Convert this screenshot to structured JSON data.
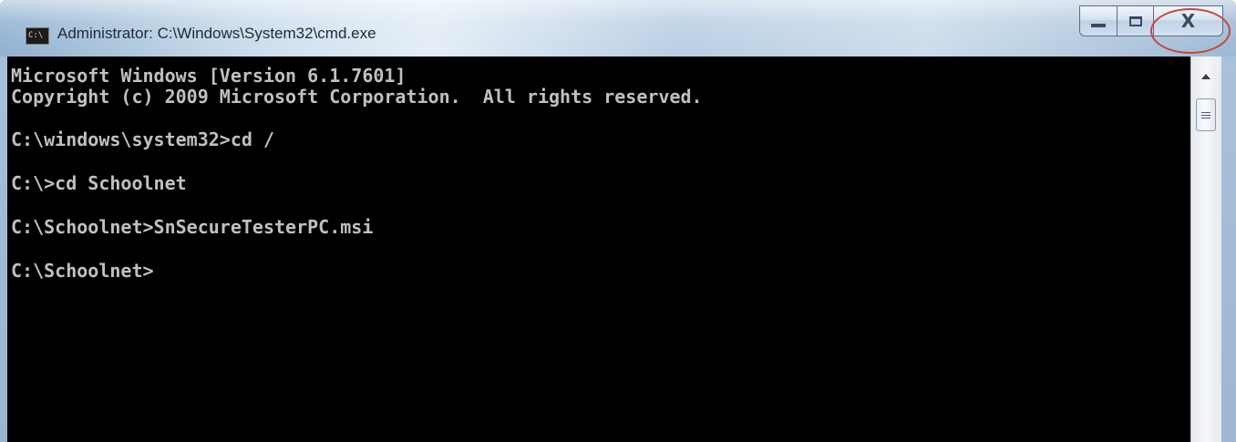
{
  "window": {
    "title": "Administrator: C:\\Windows\\System32\\cmd.exe",
    "icon": "cmd-icon",
    "icon_text": "C:\\",
    "caption_buttons": {
      "minimize_icon": "minimize-icon",
      "maximize_icon": "maximize-icon",
      "close_icon": "close-icon",
      "close_glyph": "X"
    },
    "colors": {
      "console_background": "#000000",
      "console_text": "#c0c0c0",
      "close_highlight": "#c4493a"
    }
  },
  "console": {
    "lines": [
      "Microsoft Windows [Version 6.1.7601]",
      "Copyright (c) 2009 Microsoft Corporation.  All rights reserved.",
      "",
      "C:\\windows\\system32>cd /",
      "",
      "C:\\>cd Schoolnet",
      "",
      "C:\\Schoolnet>SnSecureTesterPC.msi",
      "",
      "C:\\Schoolnet>"
    ]
  }
}
